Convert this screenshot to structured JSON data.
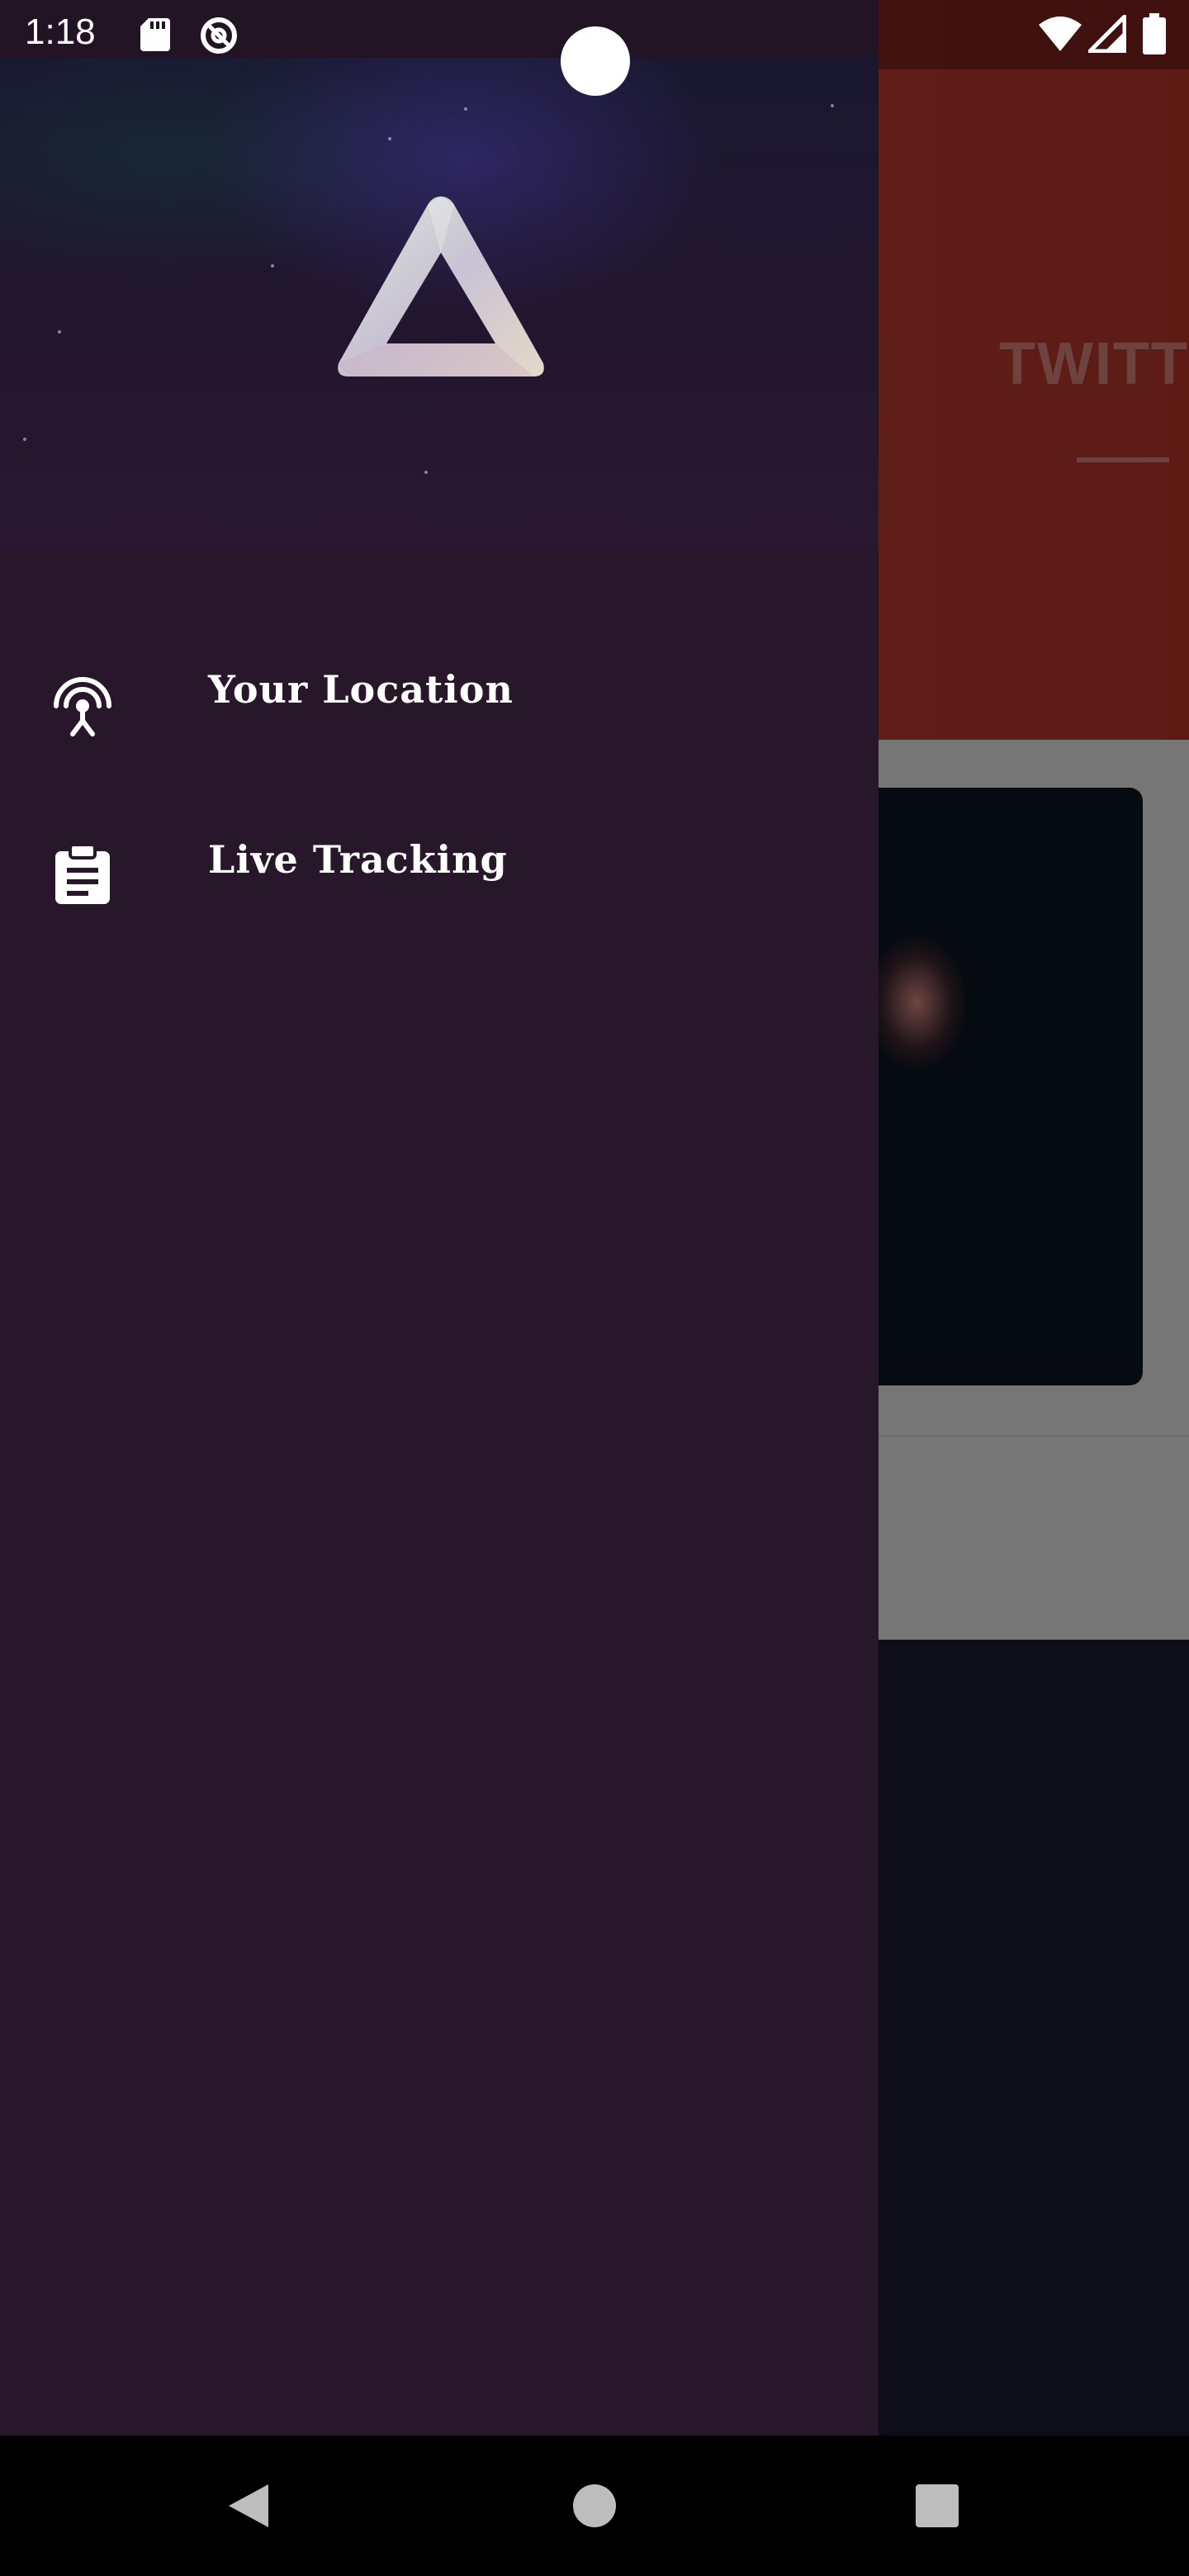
{
  "status_bar": {
    "time": "1:18",
    "left_icons": [
      "sd-card-icon",
      "data-saver-icon"
    ],
    "right_icons": [
      "wifi-icon",
      "signal-icon",
      "battery-icon"
    ]
  },
  "background_app": {
    "title": "TWITTE",
    "header_color": "#c0392b"
  },
  "drawer": {
    "background_color": "#28172a",
    "logo": "penrose-triangle-logo",
    "items": [
      {
        "label": "Your Location",
        "icon": "location-broadcast-icon"
      },
      {
        "label": "Live Tracking",
        "icon": "clipboard-icon"
      }
    ]
  },
  "nav_bar": {
    "buttons": [
      "back-icon",
      "home-icon",
      "recents-icon"
    ]
  }
}
